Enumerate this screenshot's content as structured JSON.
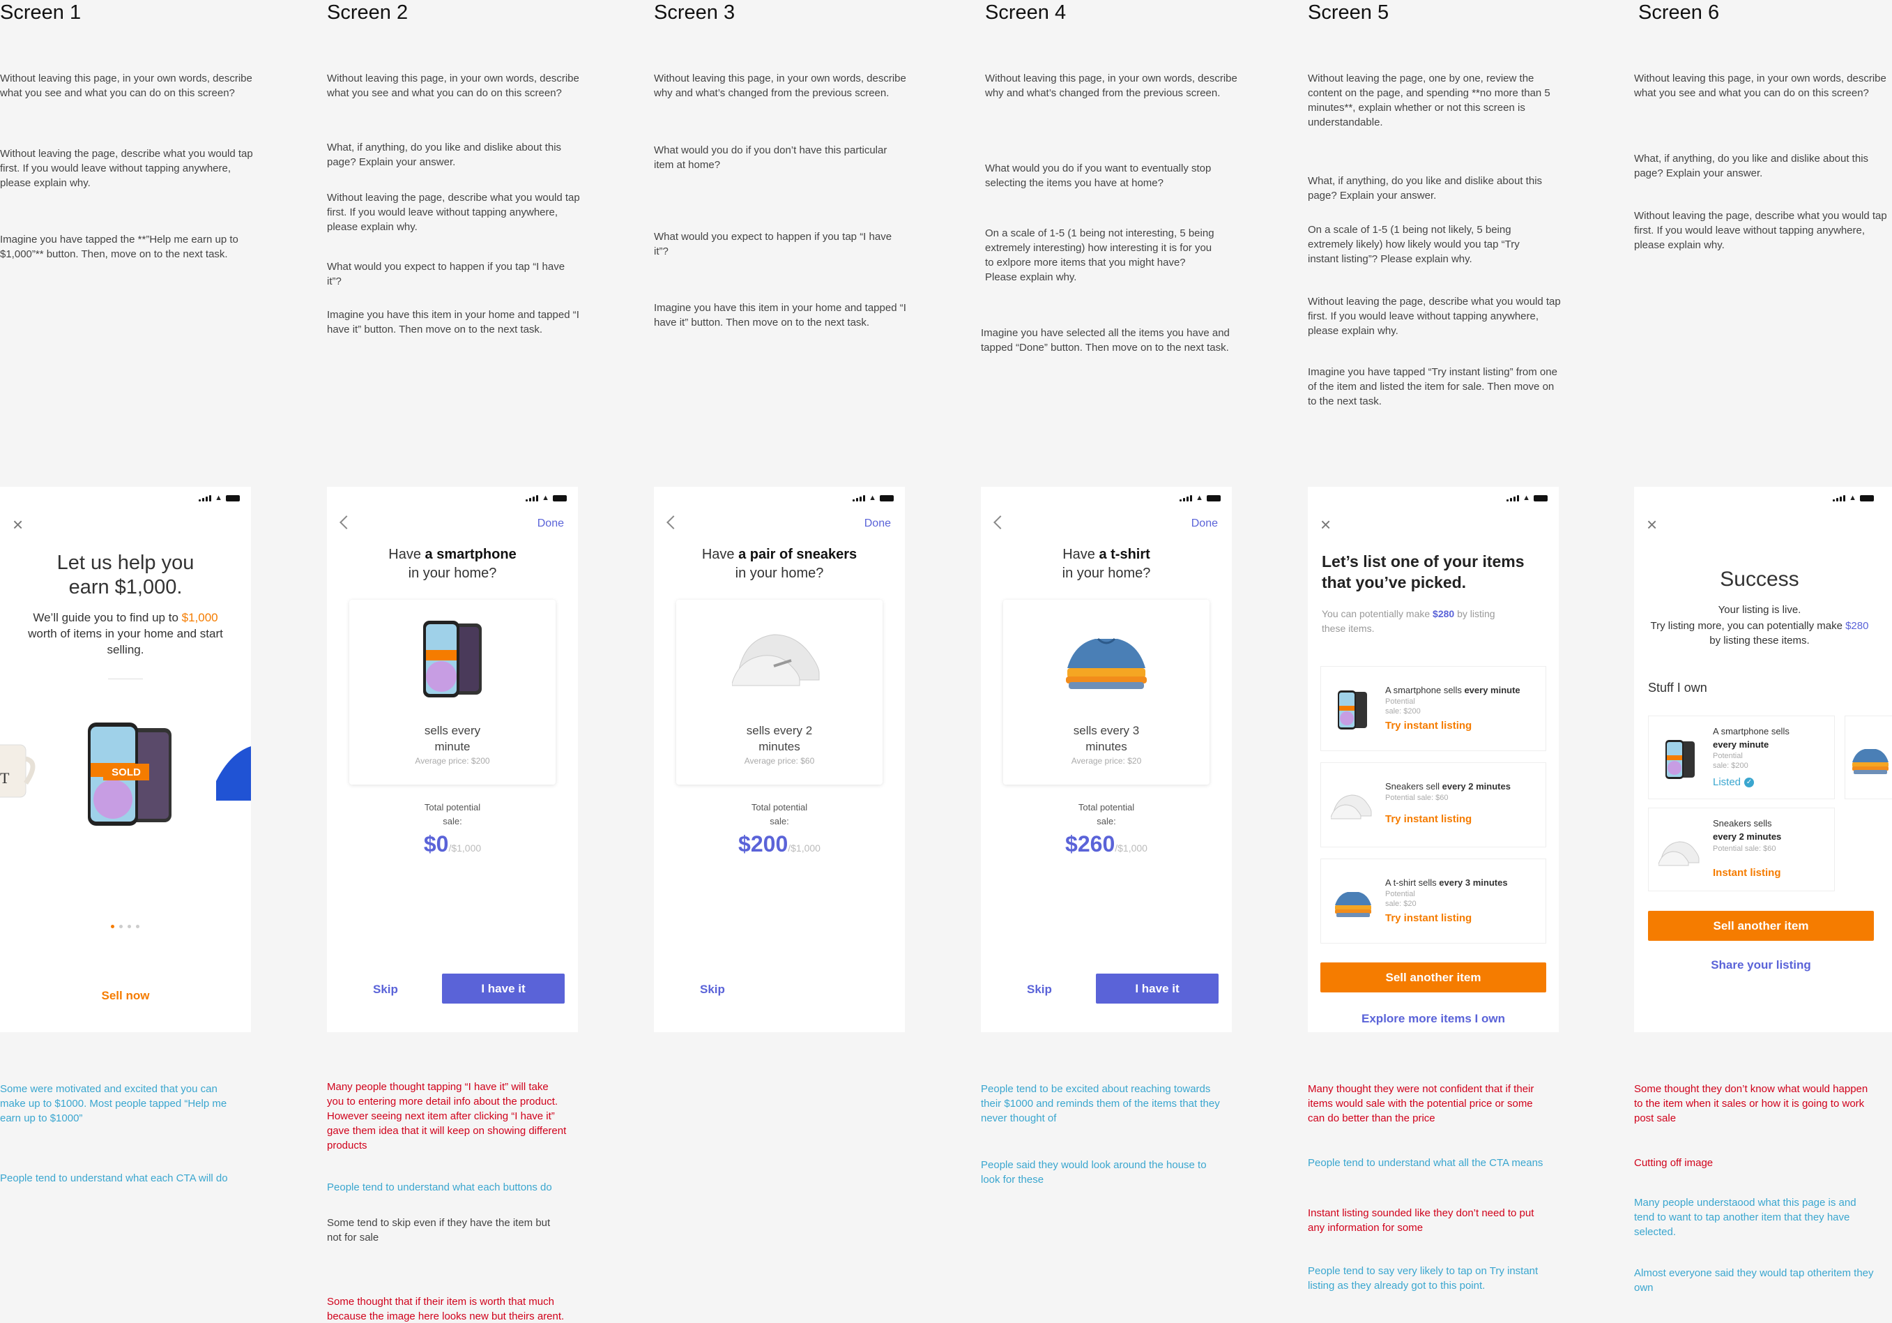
{
  "screens": [
    {
      "title": "Screen 1",
      "questions": [
        "Without leaving this page, in your own words, describe what you see and what you can do on this screen?",
        "Without leaving the page, describe what you would tap first. If you would leave without tapping anywhere, please explain why.",
        "Imagine you have tapped the **”Help me earn up to $1,000”** button. Then, move on to the next task."
      ],
      "findings": [
        {
          "text": "Some were motivated and excited that you can make up to $1000. Most people tapped “Help me earn up to $1000”",
          "color": "#3aa6cf"
        },
        {
          "text": "People tend to understand what each CTA will do",
          "color": "#3aa6cf"
        }
      ],
      "phone": {
        "headline": "Let us help you earn $1,000.",
        "sub_pre": "We’ll guide you to find up to ",
        "sub_amount": "$1,000",
        "sub_post": " worth of items in your home and start selling.",
        "sold_badge": "SOLD",
        "cta": "Sell now"
      }
    },
    {
      "title": "Screen 2",
      "questions": [
        "Without leaving this page, in your own words, describe what you see and what you can do on this screen?",
        "What, if anything, do you like and dislike about this page? Explain your answer.",
        "Without leaving the page, describe what you would tap first. If you would leave without tapping anywhere, please explain why.",
        "What would you expect to happen if you tap “I have it”?",
        "Imagine you have this item in your home and tapped “I have it” button. Then move on to the next task."
      ],
      "findings": [
        {
          "text": "Many people thought tapping “I have it” will take you to entering more detail info about the product. However seeing next item after clicking “I have it” gave them idea that it will keep on showing different products",
          "color": "#d0021b"
        },
        {
          "text": "People tend to understand what each buttons do",
          "color": "#3aa6cf"
        },
        {
          "text": "Some tend to skip even if they have the item but not for sale",
          "color": "#444444"
        },
        {
          "text": "Some thought that if their item is worth that much because the image here looks new but theirs arent.",
          "color": "#d0021b"
        }
      ],
      "phone": {
        "done": "Done",
        "have_pre": "Have ",
        "have_item": "a smartphone",
        "have_post": "in your home?",
        "sells": "sells every minute",
        "avg": "Average price: $200",
        "total": "Total potential sale:",
        "amount": "$0",
        "goal": "/$1,000",
        "skip": "Skip",
        "ihave": "I have it"
      }
    },
    {
      "title": "Screen 3",
      "questions": [
        "Without leaving this page, in your own words, describe why and what’s changed from the previous screen.",
        "What would you do if you don’t have this particular item at home?",
        "What would you expect to happen if you tap “I have it”?",
        "Imagine you have this item in your home and tapped “I have it” button. Then move on to the next task."
      ],
      "findings": [],
      "phone": {
        "done": "Done",
        "have_pre": "Have ",
        "have_item": "a pair of sneakers",
        "have_post": "in your home?",
        "sells": "sells every 2 minutes",
        "avg": "Average price: $60",
        "total": "Total potential sale:",
        "amount": "$200",
        "goal": "/$1,000",
        "skip": "Skip",
        "ihave": ""
      }
    },
    {
      "title": "Screen 4",
      "questions": [
        "Without leaving this page, in your own words, describe why and what’s changed from the previous screen.",
        "What would you do if you want to eventually stop selecting the items you have at home?",
        "On a scale of 1-5 (1 being not interesting, 5 being extremely interesting) how interesting it is for you to exlpore more items that you might have? Please explain why.",
        "Imagine you have selected all the items you have and tapped “Done” button. Then move on to the next task."
      ],
      "findings": [
        {
          "text": "People tend to be excited about reaching towards their $1000 and reminds them of the items that they never thought of",
          "color": "#3aa6cf"
        },
        {
          "text": "People said they would look around the house to look for these",
          "color": "#3aa6cf"
        }
      ],
      "phone": {
        "done": "Done",
        "have_pre": "Have ",
        "have_item": "a t-shirt",
        "have_post": "in your home?",
        "sells": "sells every 3 minutes",
        "avg": "Average price: $20",
        "total": "Total potential sale:",
        "amount": "$260",
        "goal": "/$1,000",
        "skip": "Skip",
        "ihave": "I have it"
      }
    },
    {
      "title": "Screen 5",
      "questions": [
        "Without leaving the page, one by one, review the content on the page, and spending **no more than 5 minutes**, explain whether or not this screen is understandable.",
        "What, if anything, do you like and dislike about this page? Explain your answer.",
        "On a scale of 1-5 (1 being not likely, 5 being extremely likely) how likely would you tap “Try instant listing”? Please explain why.",
        "Without leaving the page, describe what you would tap first. If you would leave without tapping anywhere, please explain why.",
        "Imagine you have tapped “Try instant listing” from one of the item and listed the item for sale. Then move on to the next task."
      ],
      "findings": [
        {
          "text": "Many thought they were not confident that if their items would sale with the potential price or some can do better than the price",
          "color": "#d0021b"
        },
        {
          "text": "People tend to understand what all the CTA means",
          "color": "#3aa6cf"
        },
        {
          "text": "Instant listing sounded like they don’t need to put any information for some",
          "color": "#d0021b"
        },
        {
          "text": "People tend to say very likely to tap on Try instant listing as they already got to this point.",
          "color": "#3aa6cf"
        }
      ],
      "phone": {
        "title": "Let’s list one of your items that you’ve picked.",
        "sub_pre": "You can potentially make ",
        "sub_amount": "$280",
        "sub_post": " by listing these items.",
        "items": [
          {
            "pre": "A smartphone sells ",
            "bold": "every minute",
            "potential": "Potential sale: $200",
            "action": "Try instant listing"
          },
          {
            "pre": "Sneakers sell ",
            "bold": "every 2 minutes",
            "potential": "Potential sale: $60",
            "action": "Try instant listing"
          },
          {
            "pre": "A t-shirt sells ",
            "bold": "every 3 minutes",
            "potential": "Potential sale: $20",
            "action": "Try instant listing"
          }
        ],
        "cta": "Sell another item",
        "link": "Explore more items I own"
      }
    },
    {
      "title": "Screen 6",
      "questions": [
        "Without leaving this page, in your own words, describe what you see and what you can do on this screen?",
        "What, if anything, do you like and dislike about this page? Explain your answer.",
        "Without leaving the page, describe what you would tap first. If you would leave without tapping anywhere, please explain why."
      ],
      "findings": [
        {
          "text": "Some thought they don’t know what would happen to the item when it sales or how it is going to work post sale",
          "color": "#d0021b"
        },
        {
          "text": "Cutting off image",
          "color": "#d0021b"
        },
        {
          "text": "Many people understaood what this page is and tend to want to tap another item that they have selected.",
          "color": "#3aa6cf"
        },
        {
          "text": "Almost everyone said they would tap otheritem they own",
          "color": "#3aa6cf"
        }
      ],
      "phone": {
        "title": "Success",
        "live": "Your listing is live.",
        "sub_pre": "Try listing more, you can potentially make ",
        "sub_amount": "$280",
        "sub_post": " by listing these items.",
        "section": "Stuff I own",
        "item1_title": "A smartphone sells",
        "item1_bold": "every minute",
        "item1_potential": "Potential sale: $200",
        "item1_status": "Listed",
        "item2_title": "Sneakers sells",
        "item2_bold": "every 2 minutes",
        "item2_potential": "Potential sale: $60",
        "item2_action": "Instant listing",
        "cta": "Sell another item",
        "link": "Share your listing"
      }
    }
  ]
}
